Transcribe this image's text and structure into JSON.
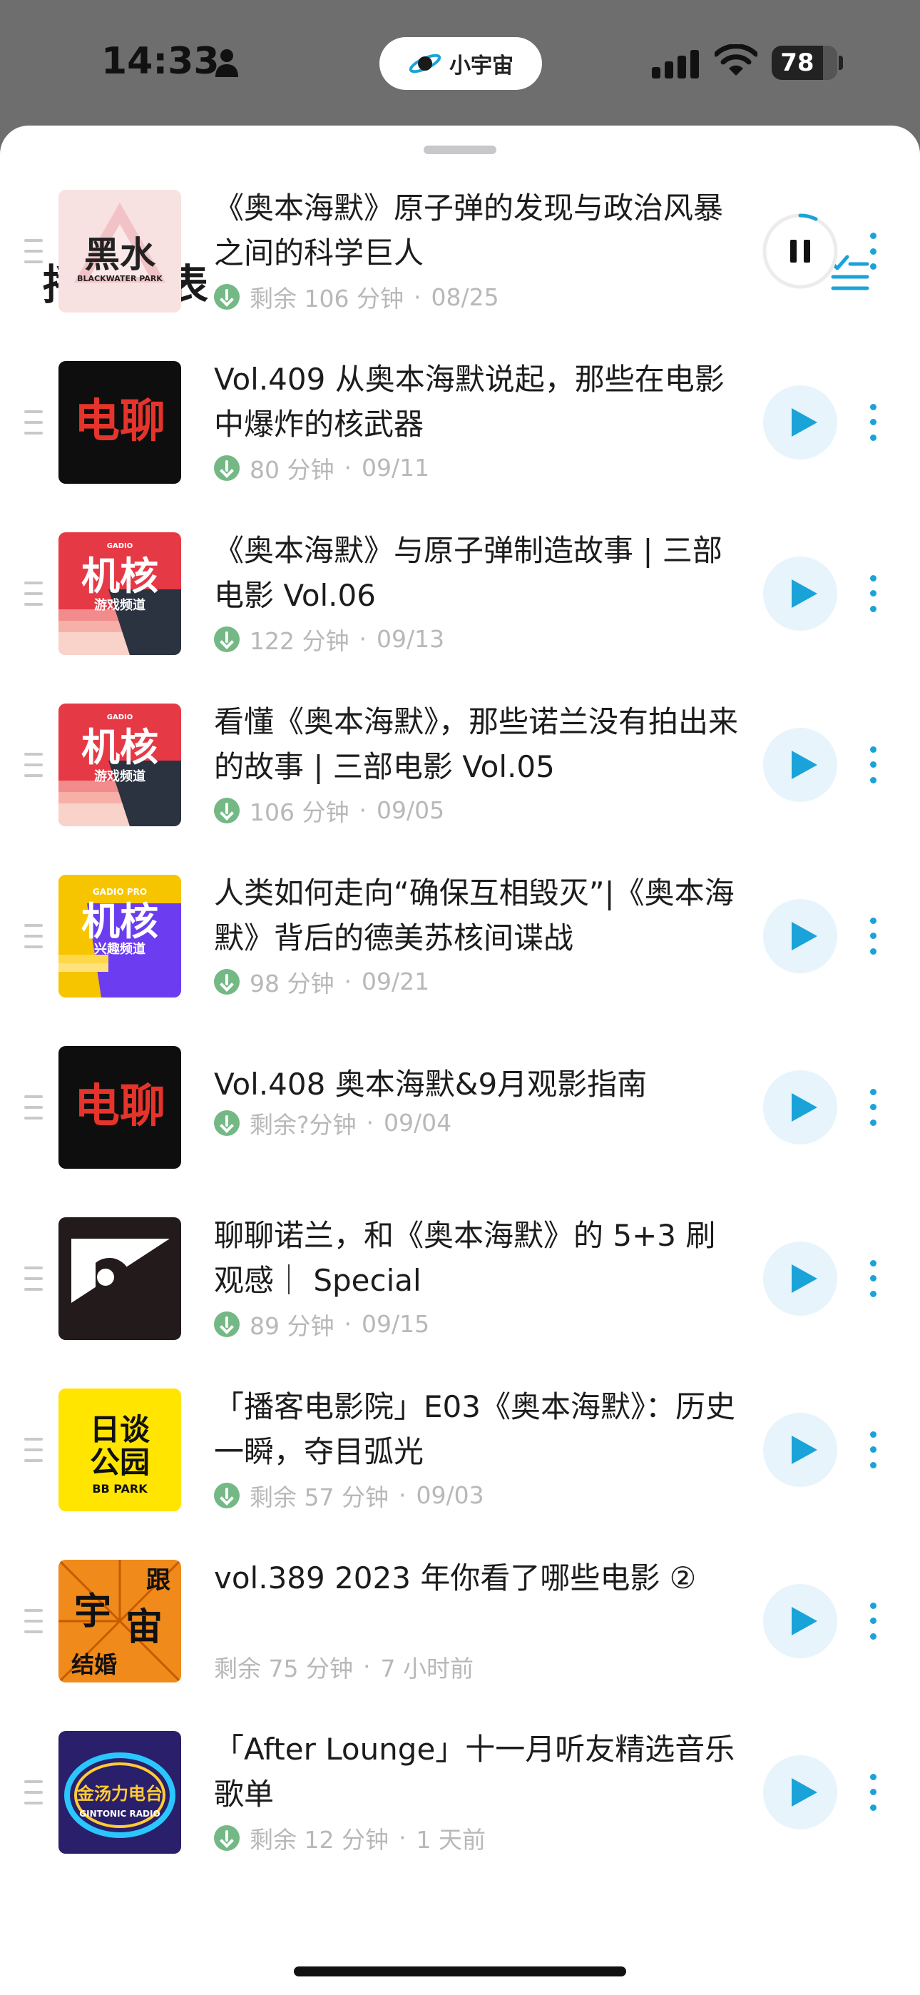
{
  "status_bar": {
    "time": "14:33",
    "island_label": "小宇宙",
    "battery": "78",
    "battery_level": 0.78
  },
  "playlist": {
    "title": "播放列表",
    "items": [
      {
        "title": "《奥本海默》原子弹的发现与政治风暴之间的科学巨人",
        "remaining": "剩余 106 分钟",
        "date": "08/25",
        "downloaded": true,
        "state": "playing",
        "cover": "black-water-park"
      },
      {
        "title": "Vol.409 从奥本海默说起，那些在电影中爆炸的核武器",
        "remaining": "80 分钟",
        "date": "09/11",
        "downloaded": true,
        "state": "paused",
        "cover": "dianliao"
      },
      {
        "title": "《奥本海默》与原子弹制造故事 | 三部电影 Vol.06",
        "remaining": "122 分钟",
        "date": "09/13",
        "downloaded": true,
        "state": "paused",
        "cover": "jihe"
      },
      {
        "title": "看懂《奥本海默》，那些诺兰没有拍出来的故事 | 三部电影 Vol.05",
        "remaining": "106 分钟",
        "date": "09/05",
        "downloaded": true,
        "state": "paused",
        "cover": "jihe"
      },
      {
        "title": "人类如何走向“确保互相毁灭”|《奥本海默》背后的德美苏核间谍战",
        "remaining": "98 分钟",
        "date": "09/21",
        "downloaded": true,
        "state": "paused",
        "cover": "jihe-pro"
      },
      {
        "title": "Vol.408 奥本海默&9月观影指南",
        "remaining": "剩余?分钟",
        "date": "09/04",
        "downloaded": true,
        "state": "paused",
        "cover": "dianliao"
      },
      {
        "title": "聊聊诺兰，和《奥本海默》的 5+3 刷观感｜ Special",
        "remaining": "89 分钟",
        "date": "09/15",
        "downloaded": true,
        "state": "paused",
        "cover": "special"
      },
      {
        "title": "「播客电影院」E03《奥本海默》：历史一瞬，夺目弧光",
        "remaining": "剩余 57 分钟",
        "date": "09/03",
        "downloaded": true,
        "state": "paused",
        "cover": "bb-park"
      },
      {
        "title": "vol.389 2023 年你看了哪些电影 ②",
        "remaining": "剩余 75 分钟",
        "date": "7 小时前",
        "downloaded": false,
        "state": "paused",
        "cover": "yuzhou"
      },
      {
        "title": "「After Lounge」十一月听友精选音乐歌单",
        "remaining": "剩余 12 分钟",
        "date": "1 天前",
        "downloaded": true,
        "state": "paused",
        "cover": "gintonic"
      }
    ]
  },
  "covers": {
    "black-water-park": {
      "big": "黑水",
      "small": "BLACKWATER PARK"
    },
    "dianliao": {
      "big": "电聊"
    },
    "jihe": {
      "top": "GADIO",
      "big": "机核",
      "sub": "游戏频道"
    },
    "jihe-pro": {
      "top": "GADIO PRO",
      "big": "机核",
      "sub": "兴趣频道"
    },
    "bb-park": {
      "big1": "日谈",
      "big2": "公园",
      "sub": "BB PARK"
    },
    "yuzhou": {
      "c1": "跟",
      "c2": "宇",
      "c3": "宙",
      "c4": "结婚"
    },
    "gintonic": {
      "big": "金汤力电台",
      "sub": "GINTONIC RADIO"
    }
  },
  "colors": {
    "accent": "#1aa3d8",
    "download_green": "#73b885",
    "meta_gray": "#b8b8b8"
  },
  "icons": [
    "person-icon",
    "signal-icon",
    "wifi-icon",
    "planet-icon",
    "manage-list-icon",
    "drag-handle-icon",
    "download-icon",
    "play-icon",
    "pause-icon",
    "more-icon"
  ],
  "meta_separator": "·"
}
